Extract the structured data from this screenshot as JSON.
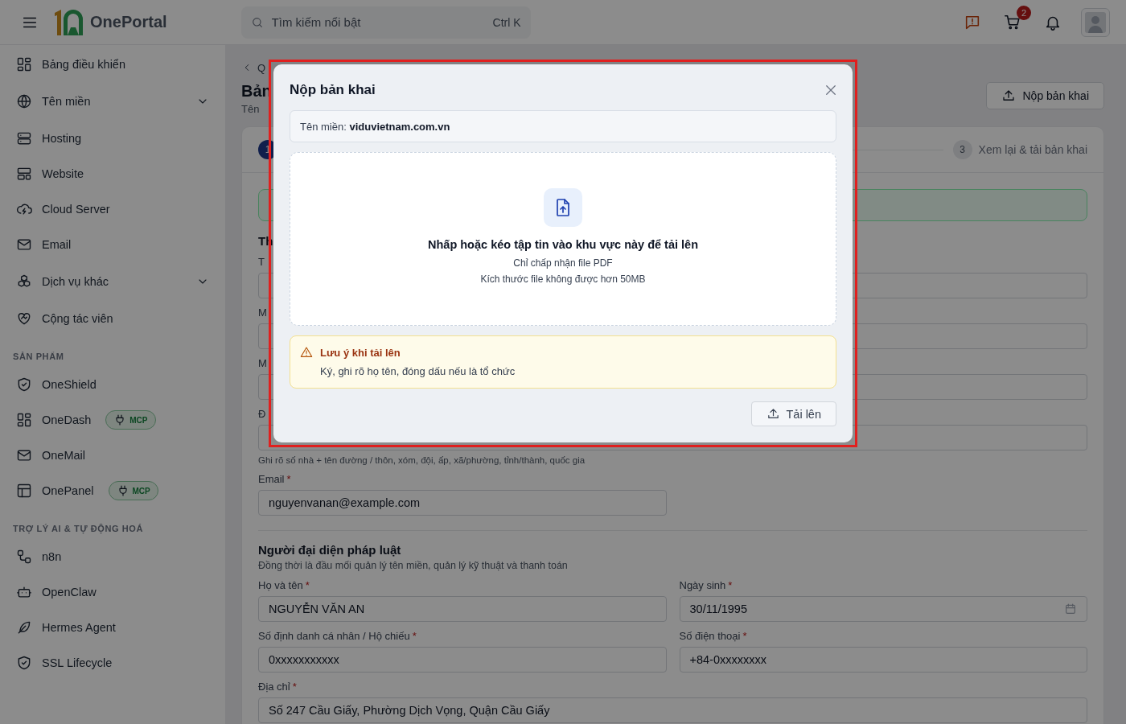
{
  "header": {
    "brand": "OnePortal",
    "search": {
      "placeholder": "Tìm kiếm nổi bật",
      "shortcut": "Ctrl K"
    },
    "cart_count": "2"
  },
  "sidebar": {
    "groups": [
      {
        "items": [
          {
            "label": "Bảng điều khiển",
            "submenu": false
          },
          {
            "label": "Tên miền",
            "submenu": true
          },
          {
            "label": "Hosting",
            "submenu": false
          },
          {
            "label": "Website",
            "submenu": false
          },
          {
            "label": "Cloud Server",
            "submenu": false
          },
          {
            "label": "Email",
            "submenu": false
          },
          {
            "label": "Dịch vụ khác",
            "submenu": true
          },
          {
            "label": "Cộng tác viên",
            "submenu": false
          }
        ]
      },
      {
        "title": "SẢN PHẨM",
        "items": [
          {
            "label": "OneShield",
            "submenu": false
          },
          {
            "label": "OneDash",
            "submenu": false,
            "badge": "MCP"
          },
          {
            "label": "OneMail",
            "submenu": false
          },
          {
            "label": "OnePanel",
            "submenu": false,
            "badge": "MCP"
          }
        ]
      },
      {
        "title": "TRỢ LÝ AI & TỰ ĐỘNG HOÁ",
        "items": [
          {
            "label": "n8n",
            "submenu": false
          },
          {
            "label": "OpenClaw",
            "submenu": false
          },
          {
            "label": "Hermes Agent",
            "submenu": false
          },
          {
            "label": "SSL Lifecycle",
            "submenu": false
          }
        ]
      }
    ]
  },
  "page": {
    "breadcrumb": "Q",
    "title": "Bản",
    "subtitle": "Tên",
    "action_button": "Nộp bản khai",
    "steps": [
      {
        "number": "1",
        "selected": true
      },
      {
        "number": "3",
        "label": "Xem lại & tải bản khai",
        "selected": false
      }
    ],
    "section_title": "Th",
    "fields": [
      {
        "label": "T",
        "wide": true
      },
      {
        "label": "M",
        "wide": true
      },
      {
        "label": "M",
        "wide": true
      },
      {
        "label": "Đ",
        "wide": true,
        "hint": "Ghi rõ số nhà + tên đường / thôn, xóm, đội, ấp, xã/phường, tỉnh/thành, quốc gia"
      },
      {
        "label": "Email",
        "required_mark": "*",
        "value": "nguyenvanan@example.com",
        "wide": false
      }
    ],
    "rep_section": {
      "title": "Người đại diện pháp luật",
      "subtitle": "Đồng thời là đầu mối quản lý tên miền, quản lý kỹ thuật và thanh toán",
      "fields": [
        {
          "label": "Họ và tên",
          "required_mark": "*",
          "value": "NGUYỄN VĂN AN",
          "kind": "text"
        },
        {
          "label": "Ngày sinh",
          "required_mark": "*",
          "value": "30/11/1995",
          "kind": "date"
        },
        {
          "label": "Số định danh cá nhân / Hộ chiếu",
          "required_mark": "*",
          "value": "0xxxxxxxxxxx",
          "kind": "text"
        },
        {
          "label": "Số điện thoại",
          "required_mark": "*",
          "value": "+84-0xxxxxxxx",
          "kind": "text"
        },
        {
          "label": "Địa chỉ",
          "required_mark": "*",
          "value": "Số 247 Cầu Giấy, Phường Dịch Vọng, Quận Cầu Giấy",
          "kind": "wide"
        }
      ]
    }
  },
  "modal": {
    "title": "Nộp bản khai",
    "domain": "Tên miền: **viduvietnam.com.vn**",
    "dropzone": {
      "title": "Nhấp hoặc kéo tập tin vào khu vực này để tải lên",
      "lines": [
        "Chỉ chấp nhận file PDF",
        "Kích thước file không được hơn 50MB"
      ]
    },
    "warning": {
      "title": "Lưu ý khi tải lên",
      "text": "Ký, ghi rõ họ tên, đóng dấu nếu là tổ chức"
    },
    "submit_button": "Tải lên"
  }
}
